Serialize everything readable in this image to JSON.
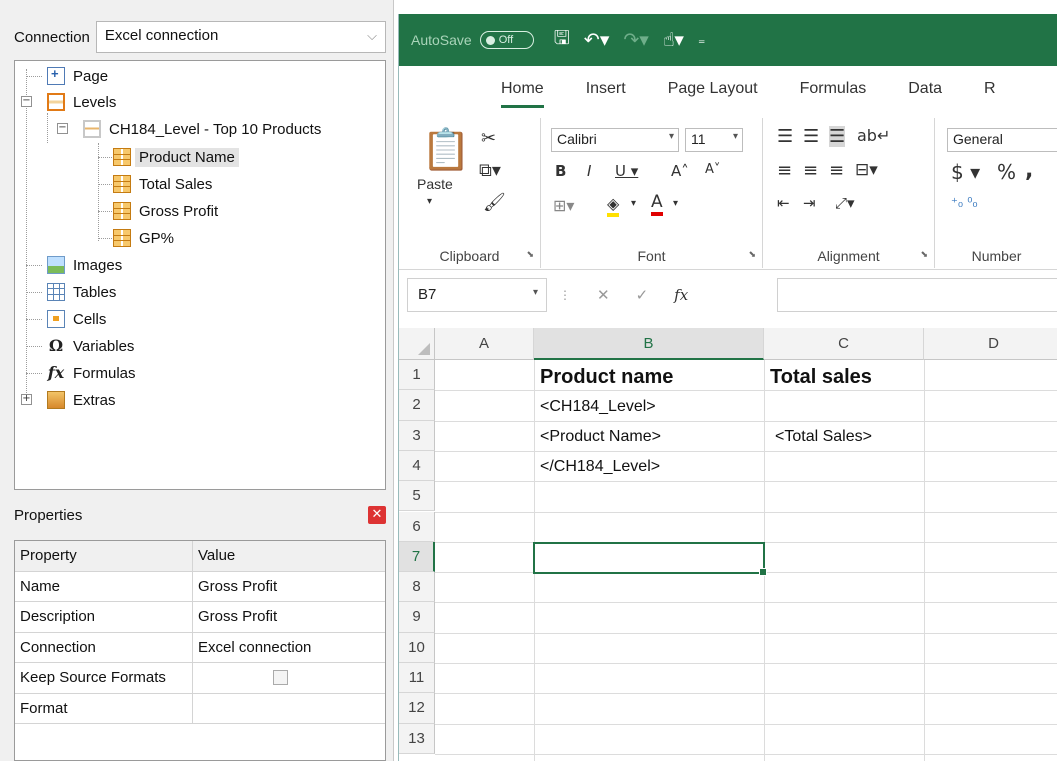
{
  "connection": {
    "label": "Connection",
    "value": "Excel connection"
  },
  "tree": {
    "page": "Page",
    "levels": "Levels",
    "level": "CH184_Level - Top 10 Products",
    "fields": [
      "Product Name",
      "Total Sales",
      "Gross Profit",
      "GP%"
    ],
    "images": "Images",
    "tables": "Tables",
    "cells": "Cells",
    "variables": "Variables",
    "formulas": "Formulas",
    "extras": "Extras"
  },
  "properties": {
    "title": "Properties",
    "header": {
      "property": "Property",
      "value": "Value"
    },
    "rows": [
      {
        "property": "Name",
        "value": "Gross Profit"
      },
      {
        "property": "Description",
        "value": "Gross Profit"
      },
      {
        "property": "Connection",
        "value": "Excel connection"
      },
      {
        "property": "Keep Source Formats",
        "value": ""
      },
      {
        "property": "Format",
        "value": ""
      }
    ]
  },
  "excel": {
    "autosave_label": "AutoSave",
    "autosave_state": "Off",
    "tabs": [
      "Home",
      "Insert",
      "Page Layout",
      "Formulas",
      "Data",
      "R"
    ],
    "ribbon": {
      "paste": "Paste",
      "clipboard": "Clipboard",
      "font_name": "Calibri",
      "font_size": "11",
      "font": "Font",
      "alignment": "Alignment",
      "number_format": "General",
      "number": "Number"
    },
    "name_box": "B7",
    "columns": [
      "A",
      "B",
      "C",
      "D"
    ],
    "rows": [
      "1",
      "2",
      "3",
      "4",
      "5",
      "6",
      "7",
      "8",
      "9",
      "10",
      "11",
      "12",
      "13"
    ],
    "cells": {
      "B1": "Product name",
      "C1": "Total sales",
      "B2": "<CH184_Level>",
      "B3": "<Product Name>",
      "C3": "<Total Sales>",
      "B4": "</CH184_Level>"
    },
    "accent": "#217346"
  }
}
